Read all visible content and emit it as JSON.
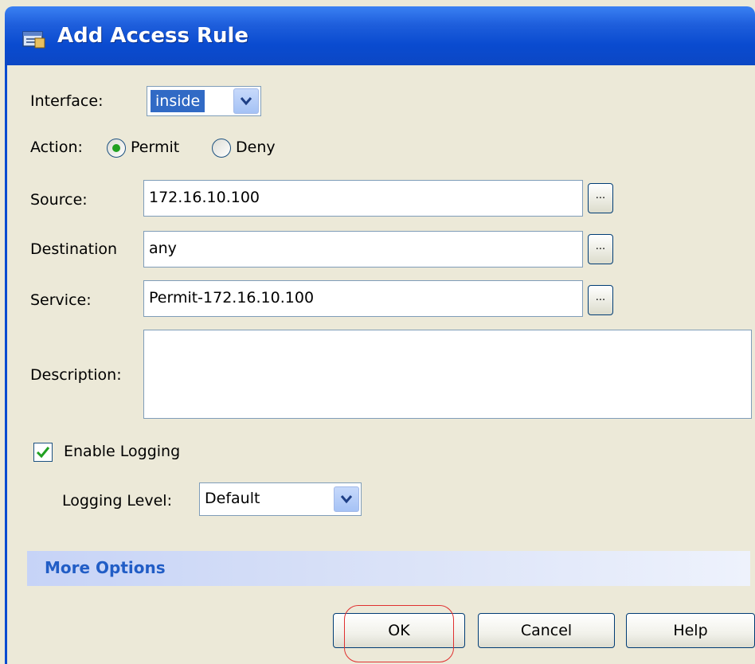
{
  "window": {
    "title": "Add Access Rule",
    "icon": "access-rule-icon"
  },
  "form": {
    "interface_label": "Interface:",
    "interface_value": "inside",
    "action_label": "Action:",
    "action_permit": "Permit",
    "action_deny": "Deny",
    "action_selected": "Permit",
    "source_label": "Source:",
    "source_value": "172.16.10.100",
    "destination_label": "Destination",
    "destination_value": "any",
    "service_label": "Service:",
    "service_value": "Permit-172.16.10.100",
    "description_label": "Description:",
    "description_value": "",
    "browse_label": "...",
    "enable_logging_label": "Enable Logging",
    "enable_logging_checked": true,
    "logging_level_label": "Logging Level:",
    "logging_level_value": "Default"
  },
  "more_options": {
    "label": "More Options"
  },
  "buttons": {
    "ok": "OK",
    "cancel": "Cancel",
    "help": "Help"
  },
  "colors": {
    "titlebar": "#0a4bd0",
    "window_bg": "#ece9d8",
    "selection": "#316ac5",
    "more_options_text": "#215dc6",
    "highlight_ring": "#e03030"
  }
}
